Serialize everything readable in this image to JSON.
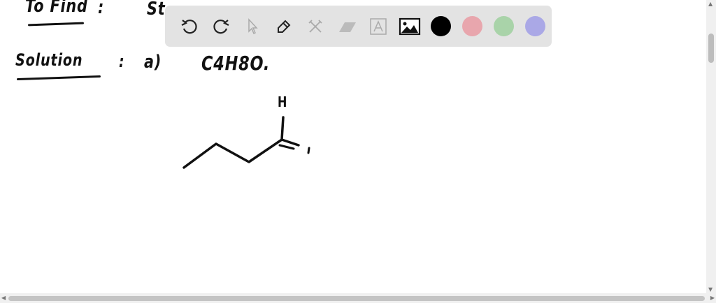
{
  "board": {
    "to_find_label": "To Find",
    "to_find_colon": ":",
    "to_find_value": "St",
    "solution_label": "Solution",
    "solution_colon": ":",
    "part": "a)",
    "formula": "C4H8O.",
    "atom_label": "H"
  },
  "toolbar": {
    "tools": [
      "undo-icon",
      "redo-icon",
      "pointer-icon",
      "pen-icon",
      "tools-icon",
      "eraser-icon",
      "text-icon",
      "image-icon"
    ],
    "colors": [
      "#000000",
      "#e8a6ad",
      "#a9d3a9",
      "#aaa8e6"
    ]
  }
}
